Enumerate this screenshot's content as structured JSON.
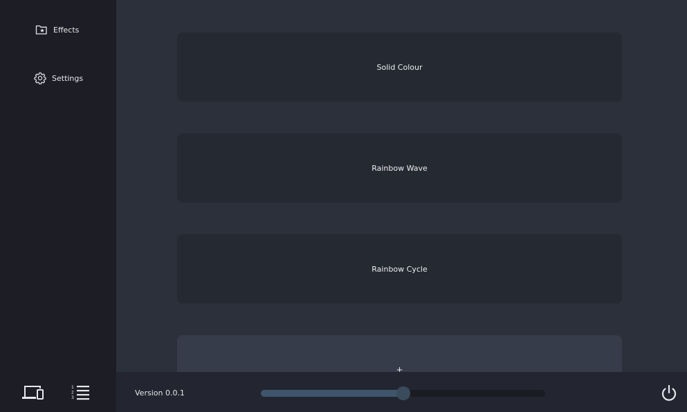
{
  "sidebar": {
    "items": [
      {
        "label": "Effects",
        "icon": "folder-star-icon"
      },
      {
        "label": "Settings",
        "icon": "gear-icon"
      }
    ],
    "bottom_icons": [
      "devices-icon",
      "numbered-list-icon"
    ]
  },
  "main": {
    "effects": [
      {
        "label": "Solid Colour"
      },
      {
        "label": "Rainbow Wave"
      },
      {
        "label": "Rainbow Cycle"
      }
    ],
    "add_label": "+"
  },
  "bottombar": {
    "version": "Version 0.0.1",
    "brightness_fraction": 0.5,
    "power_icon": "power-icon"
  },
  "colors": {
    "sidebar_bg": "#1d1e25",
    "main_bg": "#2c303b",
    "card_bg": "#252932",
    "add_card_bg": "#363c4a",
    "slider_fill": "#3e556b"
  }
}
